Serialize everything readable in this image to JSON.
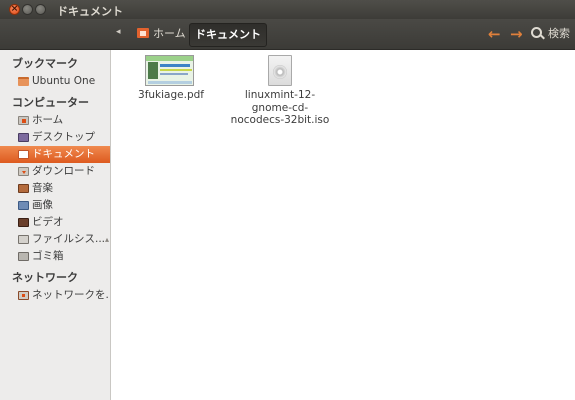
{
  "window": {
    "title": "ドキュメント"
  },
  "toolbar": {
    "breadcrumbs": [
      "ホーム",
      "ドキュメント"
    ],
    "search_label": "検索"
  },
  "sidebar": {
    "sections": [
      {
        "header": "ブックマーク",
        "items": [
          {
            "label": "Ubuntu One",
            "icon": "folder-icon"
          }
        ]
      },
      {
        "header": "コンピューター",
        "items": [
          {
            "label": "ホーム",
            "icon": "home-folder-icon"
          },
          {
            "label": "デスクトップ",
            "icon": "desktop-icon"
          },
          {
            "label": "ドキュメント",
            "icon": "documents-icon",
            "active": true
          },
          {
            "label": "ダウンロード",
            "icon": "download-icon"
          },
          {
            "label": "音楽",
            "icon": "music-icon"
          },
          {
            "label": "画像",
            "icon": "pictures-icon"
          },
          {
            "label": "ビデオ",
            "icon": "video-icon"
          },
          {
            "label": "ファイルシス...",
            "icon": "filesystem-icon"
          },
          {
            "label": "ゴミ箱",
            "icon": "trash-icon"
          }
        ]
      },
      {
        "header": "ネットワーク",
        "items": [
          {
            "label": "ネットワークを...",
            "icon": "network-icon"
          }
        ]
      }
    ]
  },
  "files": [
    {
      "name": "3fukiage.pdf",
      "type": "pdf",
      "icon": "pdf-thumbnail"
    },
    {
      "name_lines": [
        "linuxmint-12-",
        "gnome-cd-",
        "nocodecs-32bit.iso"
      ],
      "type": "iso",
      "icon": "disc-image-icon"
    }
  ],
  "colors": {
    "accent": "#dd5a1f",
    "toolbar": "#3c3b37",
    "sidebar": "#edeceb"
  }
}
